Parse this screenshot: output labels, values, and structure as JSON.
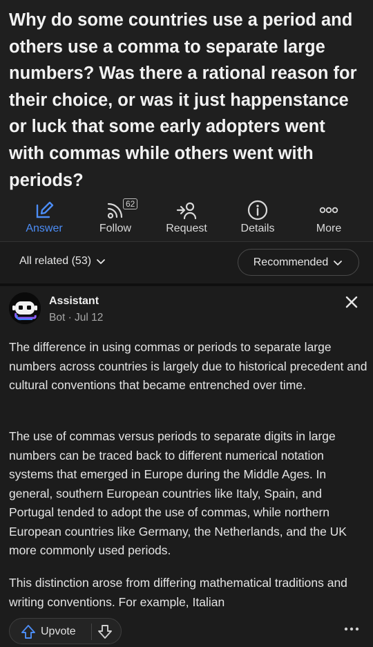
{
  "question": {
    "title": "Why do some countries use a period and others use a comma to separate large numbers? Was there a rational reason for their choice, or was it just happenstance or luck that some early adopters went with commas while others went with periods?"
  },
  "actions": [
    {
      "label": "Answer",
      "icon": "pencil-square-icon"
    },
    {
      "label": "Follow",
      "icon": "rss-follow-icon",
      "badge": "62"
    },
    {
      "label": "Request",
      "icon": "request-person-icon"
    },
    {
      "label": "Details",
      "icon": "info-circle-icon"
    },
    {
      "label": "More",
      "icon": "more-dots-icon"
    }
  ],
  "filters": {
    "all_related": "All related (53)",
    "sort": "Recommended"
  },
  "answer": {
    "author": "Assistant",
    "meta": "Bot · Jul 12",
    "paragraphs": [
      "The difference in using commas or periods to separate large numbers across countries is largely due to historical precedent and cultural conventions that became entrenched over time.",
      "The use of commas versus periods to separate digits in large numbers can be traced back to different numerical notation systems that emerged in Europe during the Middle Ages. In general, southern European countries like Italy, Spain, and Portugal tended to adopt the use of commas, while northern European countries like Germany, the Netherlands, and the UK more commonly used periods.",
      "This distinction arose from differing mathematical traditions and writing conventions. For example, Italian"
    ]
  },
  "footer": {
    "upvote_label": "Upvote"
  },
  "colors": {
    "accent": "#4c8df6",
    "background": "#181818",
    "card": "#1c1c1c"
  }
}
